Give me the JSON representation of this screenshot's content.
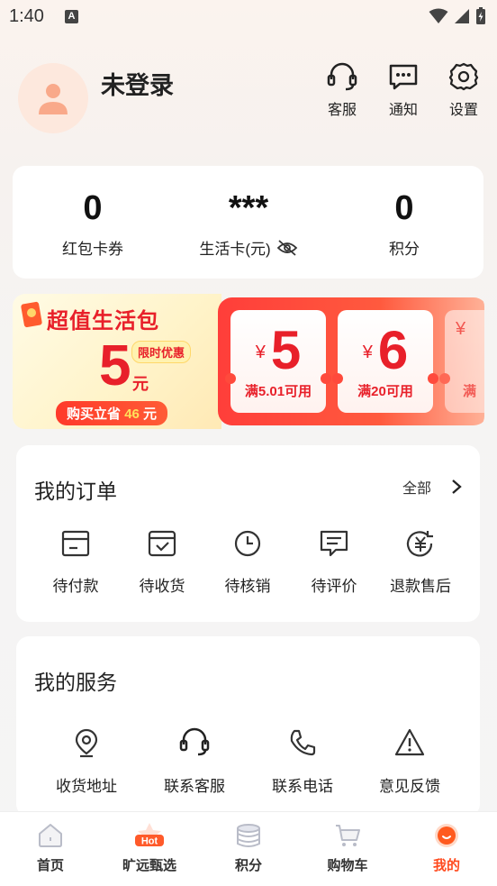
{
  "status_bar": {
    "time": "1:40",
    "notif_badge": "A"
  },
  "header": {
    "user_name": "未登录",
    "actions": [
      {
        "label": "客服",
        "icon": "headset-icon"
      },
      {
        "label": "通知",
        "icon": "message-icon"
      },
      {
        "label": "设置",
        "icon": "gear-icon"
      }
    ]
  },
  "stats": [
    {
      "value": "0",
      "label": "红包卡券"
    },
    {
      "value": "***",
      "label": "生活卡(元)"
    },
    {
      "value": "0",
      "label": "积分"
    }
  ],
  "promo": {
    "title": "超值生活包",
    "price": "5",
    "unit": "元",
    "tag": "限时优惠",
    "save_prefix": "购买立省",
    "save_amount": "46",
    "save_suffix": "元",
    "coupons": [
      {
        "currency": "¥",
        "amount": "5",
        "condition": "满5.01可用"
      },
      {
        "currency": "¥",
        "amount": "6",
        "condition": "满20可用"
      },
      {
        "currency": "¥",
        "amount": "",
        "condition": "满"
      }
    ]
  },
  "orders": {
    "title": "我的订单",
    "more_label": "全部",
    "items": [
      {
        "label": "待付款",
        "icon": "wallet-icon"
      },
      {
        "label": "待收货",
        "icon": "package-icon"
      },
      {
        "label": "待核销",
        "icon": "clock-icon"
      },
      {
        "label": "待评价",
        "icon": "comment-icon"
      },
      {
        "label": "退款售后",
        "icon": "refund-icon"
      }
    ]
  },
  "services": {
    "title": "我的服务",
    "items": [
      {
        "label": "收货地址",
        "icon": "location-icon"
      },
      {
        "label": "联系客服",
        "icon": "headset-icon"
      },
      {
        "label": "联系电话",
        "icon": "phone-icon"
      },
      {
        "label": "意见反馈",
        "icon": "warning-icon"
      }
    ]
  },
  "tabbar": {
    "active": 4,
    "tabs": [
      {
        "label": "首页",
        "icon": "home-icon"
      },
      {
        "label": "旷远甄选",
        "icon": "hot-icon",
        "badge": "Hot"
      },
      {
        "label": "积分",
        "icon": "coins-icon"
      },
      {
        "label": "购物车",
        "icon": "cart-icon"
      },
      {
        "label": "我的",
        "icon": "profile-icon"
      }
    ]
  },
  "colors": {
    "accent": "#ff4a1e",
    "promo_red": "#e8202a",
    "background": "#f5f5f5"
  }
}
